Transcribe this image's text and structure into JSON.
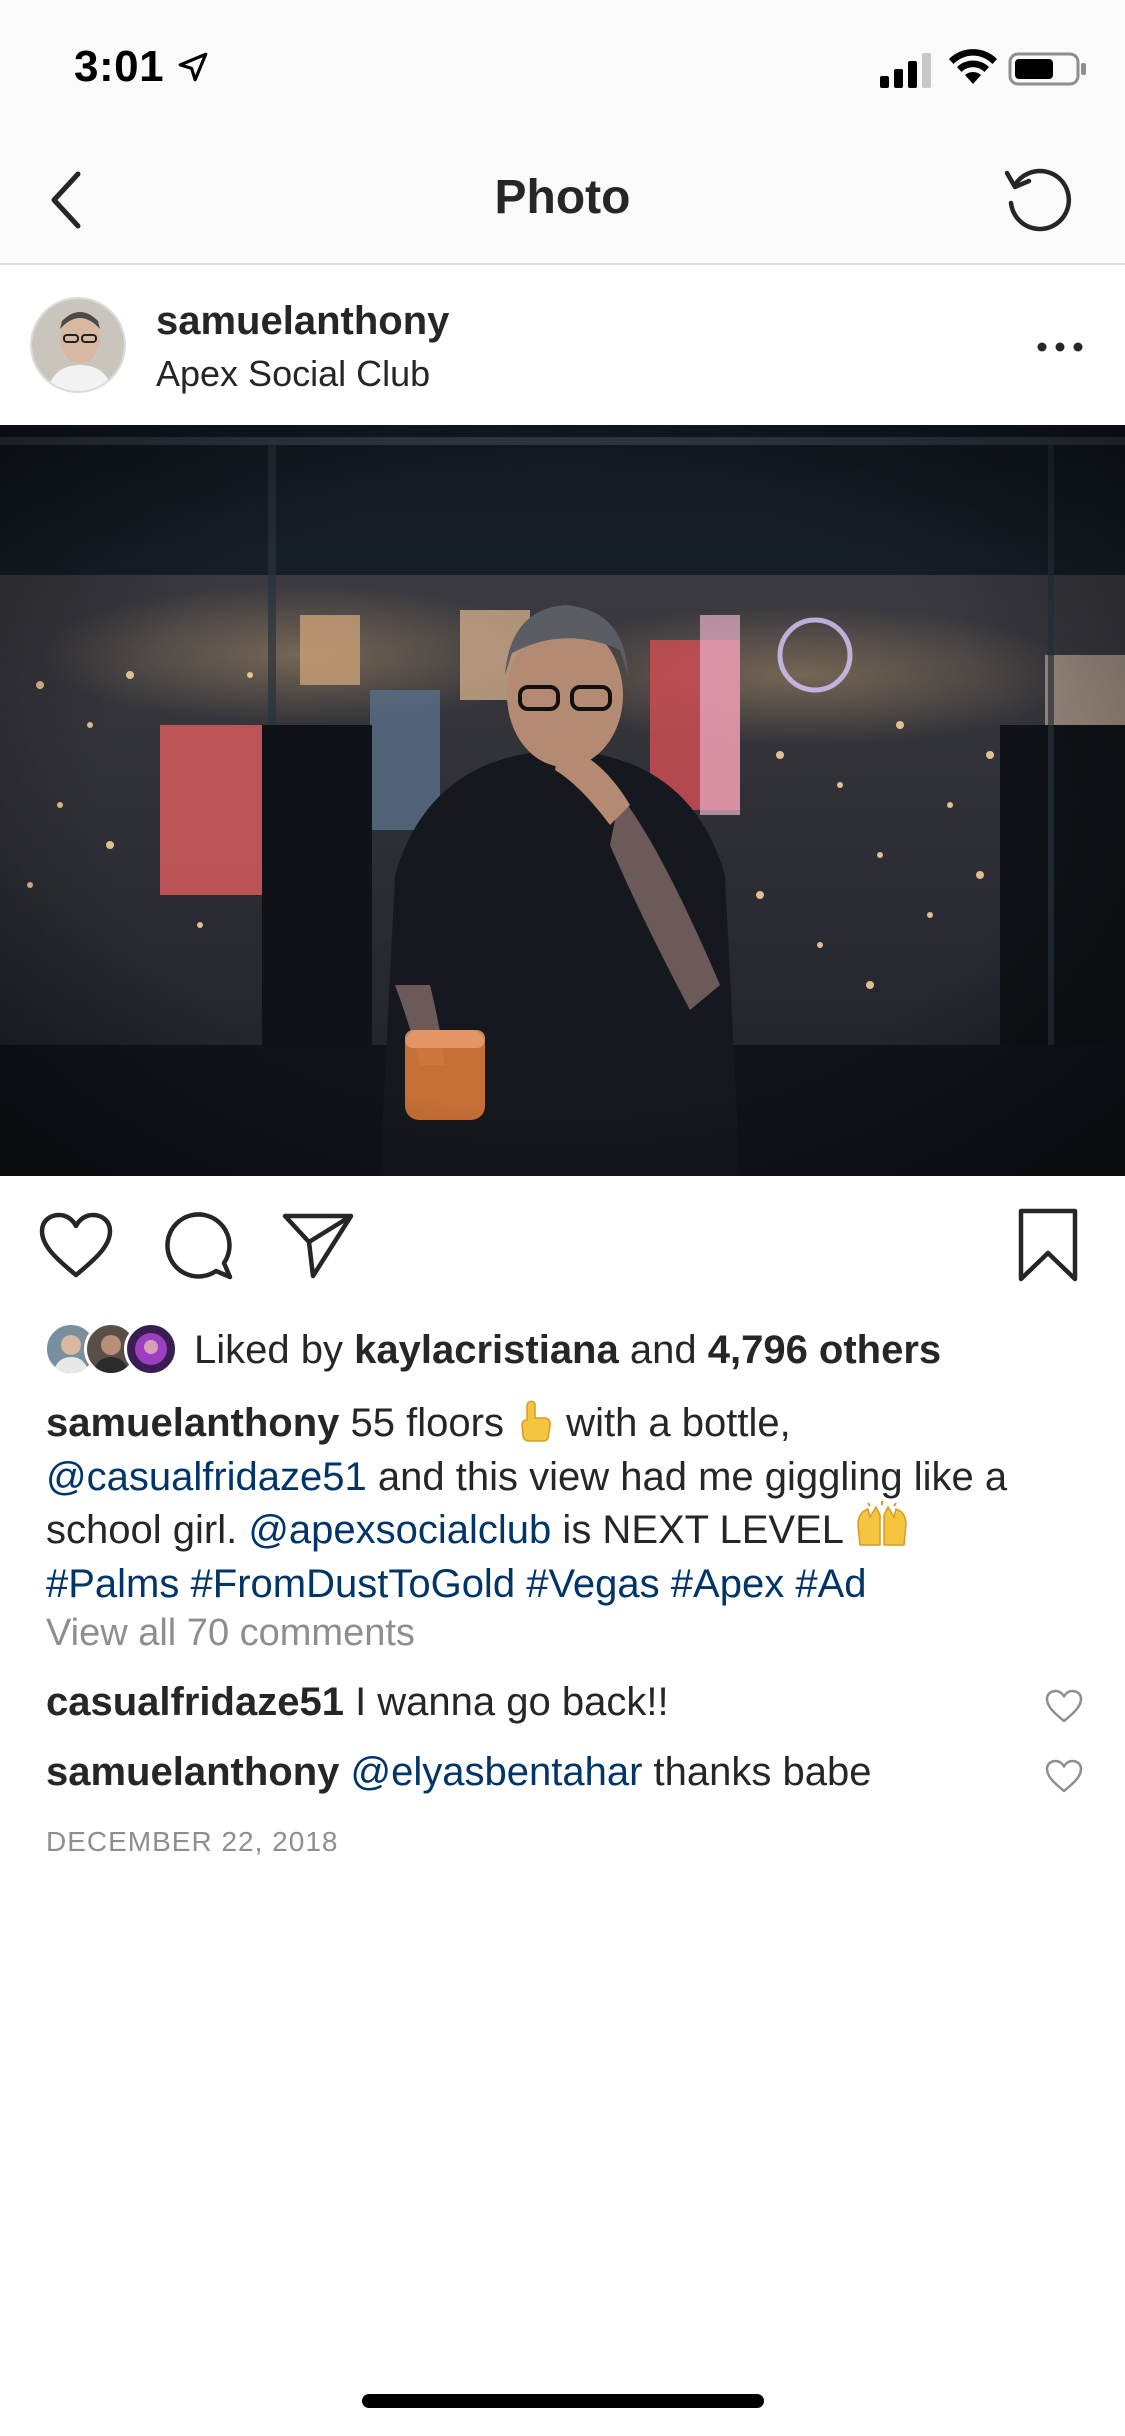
{
  "status_bar": {
    "time": "3:01"
  },
  "nav": {
    "title": "Photo"
  },
  "post": {
    "username": "samuelanthony",
    "location": "Apex Social Club",
    "likes": {
      "prefix": "Liked by ",
      "liker": "kaylacristiana",
      "middle": " and ",
      "count": "4,796 others"
    },
    "caption": {
      "username": "samuelanthony",
      "text_1": " 55 floors ",
      "text_2": " with a bottle,",
      "mention_1": "@casualfridaze51",
      "text_3": " and this view had me giggling like a school girl. ",
      "mention_2": "@apexsocialclub",
      "text_4": " is NEXT LEVEL ",
      "hashtags": [
        "#Palms",
        "#FromDustToGold",
        "#Vegas",
        "#Apex",
        "#Ad"
      ]
    },
    "view_all_comments": "View all 70 comments",
    "comments": [
      {
        "username": "casualfridaze51",
        "text": " I wanna go back!!"
      },
      {
        "username": "samuelanthony",
        "mention": "@elyasbentahar",
        "text": " thanks babe"
      }
    ],
    "date": "DECEMBER 22, 2018"
  },
  "colors": {
    "link": "#003569",
    "muted": "#8e8e8e",
    "text": "#262626",
    "bar_bg": "#fafafa"
  },
  "icons": {
    "back": "chevron-left-icon",
    "refresh": "refresh-icon",
    "more": "ellipsis-icon",
    "like": "heart-icon",
    "comment": "comment-bubble-icon",
    "share": "paper-plane-icon",
    "save": "bookmark-icon"
  }
}
